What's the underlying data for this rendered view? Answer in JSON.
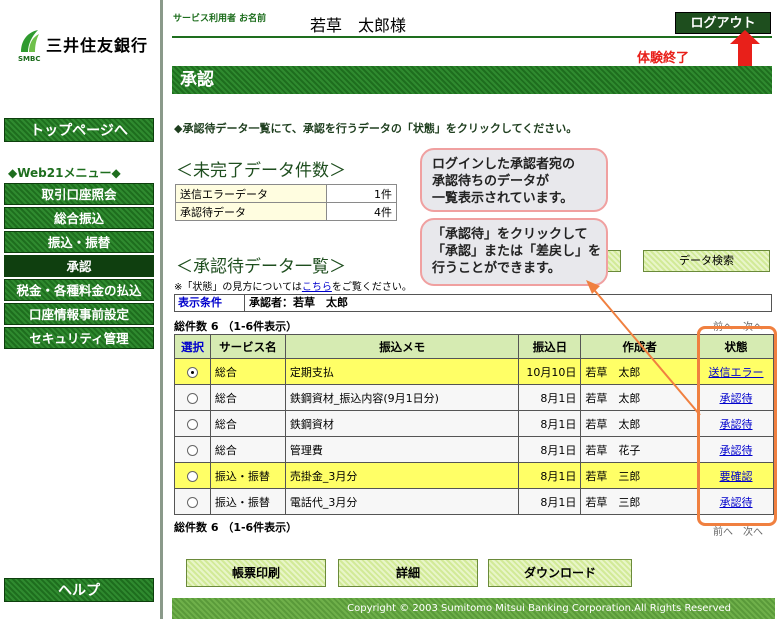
{
  "logo": {
    "name": "三井住友銀行",
    "smbc": "SMBC"
  },
  "sidebar": {
    "top_button": "トップページへ",
    "menu_heading": "◆Web21メニュー◆",
    "items": [
      {
        "label": "取引口座照会"
      },
      {
        "label": "総合振込"
      },
      {
        "label": "振込・振替"
      },
      {
        "label": "承認"
      },
      {
        "label": "税金・各種料金の払込"
      },
      {
        "label": "口座情報事前設定"
      },
      {
        "label": "セキュリティ管理"
      }
    ],
    "help_button": "ヘルプ"
  },
  "header": {
    "user_label": "サービス利用者 お名前",
    "user_name": "若草　太郎様",
    "logout_button": "ログアウト",
    "exit_label": "体験終了"
  },
  "page": {
    "title": "承認",
    "intro": "◆承認待データ一覧にて、承認を行うデータの「状態」をクリックしてください。"
  },
  "pending": {
    "title": "＜未完了データ件数＞",
    "rows": [
      {
        "label": "送信エラーデータ",
        "count": "1件"
      },
      {
        "label": "承認待データ",
        "count": "4件"
      }
    ]
  },
  "list": {
    "title": "＜承認待データ一覧＞",
    "search_button": "データ検索",
    "note_before": "※「状態」の見方については",
    "note_link": "こちら",
    "note_after": "をご覧ください。",
    "cond_label": "表示条件",
    "cond_value": "承認者：若草　太郎",
    "total": "総件数 6 （1-6件表示）",
    "pager": "前へ　次へ",
    "headers": [
      "選択",
      "サービス名",
      "振込メモ",
      "振込日",
      "作成者",
      "状態"
    ],
    "rows": [
      {
        "service": "総合",
        "memo": "定期支払",
        "date": "10月10日",
        "author": "若草　太郎",
        "status": "送信エラー"
      },
      {
        "service": "総合",
        "memo": "鉄鋼資材_振込内容(9月1日分)",
        "date": "8月1日",
        "author": "若草　太郎",
        "status": "承認待"
      },
      {
        "service": "総合",
        "memo": "鉄鋼資材",
        "date": "8月1日",
        "author": "若草　太郎",
        "status": "承認待"
      },
      {
        "service": "総合",
        "memo": "管理費",
        "date": "8月1日",
        "author": "若草　花子",
        "status": "承認待"
      },
      {
        "service": "振込・振替",
        "memo": "売掛金_3月分",
        "date": "8月1日",
        "author": "若草　三郎",
        "status": "要確認"
      },
      {
        "service": "振込・振替",
        "memo": "電話代_3月分",
        "date": "8月1日",
        "author": "若草　三郎",
        "status": "承認待"
      }
    ]
  },
  "actions": {
    "print": "帳票印刷",
    "detail": "詳細",
    "download": "ダウンロード"
  },
  "footer": {
    "copyright": "Copyright © 2003 Sumitomo Mitsui Banking Corporation.All Rights Reserved"
  },
  "callouts": {
    "first": [
      "ログインした承認者宛の",
      "承認待ちのデータが",
      "一覧表示されています。"
    ],
    "second": [
      "「承認待」をクリックして",
      "「承認」または「差戻し」を",
      "行うことができます。"
    ]
  },
  "colors": {
    "brand_green": "#1e6e1e",
    "highlight_row": "#ffff66",
    "callout_border": "#f0a0a0",
    "annotation_orange": "#f08040",
    "exit_red": "#e8201a"
  }
}
